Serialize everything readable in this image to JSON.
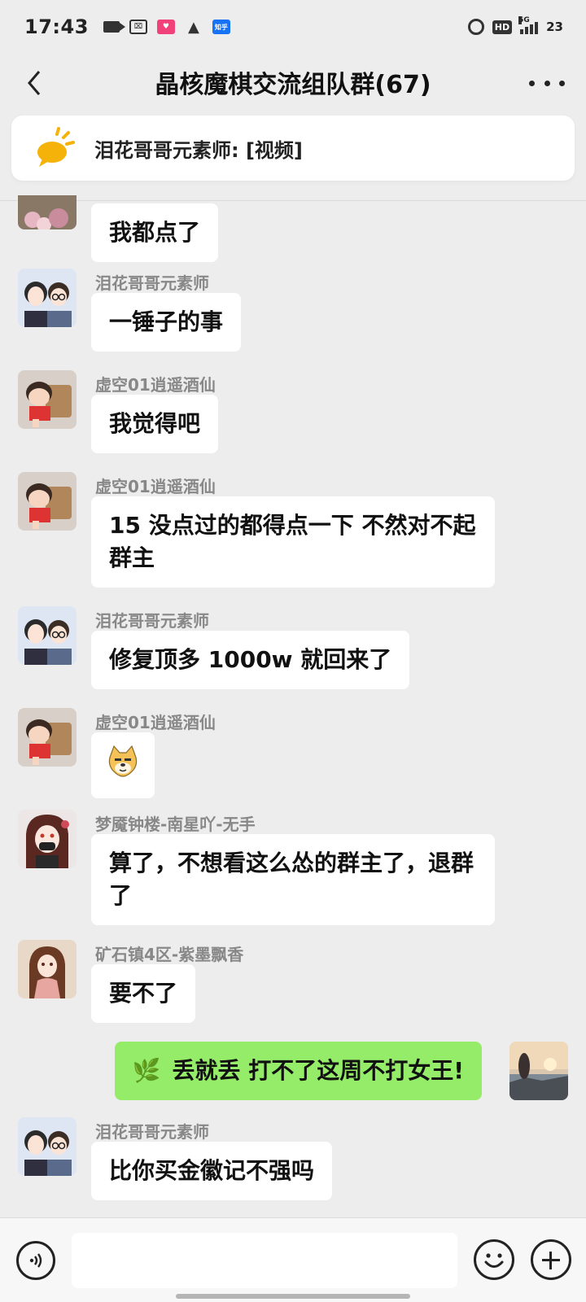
{
  "status_bar": {
    "time": "17:43",
    "app_icons": [
      "video-icon",
      "scan-icon",
      "pink-app-icon",
      "bird-icon",
      "zhihu-icon"
    ],
    "zhihu_label": "知乎",
    "hd_label": "HD",
    "network": "5G",
    "battery": "23"
  },
  "header": {
    "title": "晶核魔棋交流组队群(67)"
  },
  "pinned": {
    "text": "泪花哥哥元素师: [视频]"
  },
  "messages": [
    {
      "sender": "",
      "text": "我都点了",
      "self": false,
      "avatar": "flowers-avatar"
    },
    {
      "sender": "泪花哥哥元素师",
      "text": "一锤子的事",
      "self": false,
      "avatar": "couple-avatar"
    },
    {
      "sender": "虚空01逍遥酒仙",
      "text": "我觉得吧",
      "self": false,
      "avatar": "shinchan-avatar"
    },
    {
      "sender": "虚空01逍遥酒仙",
      "text": "15 没点过的都得点一下 不然对不起群主",
      "self": false,
      "avatar": "shinchan-avatar"
    },
    {
      "sender": "泪花哥哥元素师",
      "text": "修复顶多 1000w 就回来了",
      "self": false,
      "avatar": "couple-avatar"
    },
    {
      "sender": "虚空01逍遥酒仙",
      "text": "",
      "self": false,
      "avatar": "shinchan-avatar",
      "emoji": "doge-emoji"
    },
    {
      "sender": "梦魇钟楼-南星吖-无手",
      "text": "算了，不想看这么怂的群主了，退群了",
      "self": false,
      "avatar": "anime-girl-avatar"
    },
    {
      "sender": "矿石镇4区-紫墨飘香",
      "text": "要不了",
      "self": false,
      "avatar": "anime-girl2-avatar"
    },
    {
      "sender": "",
      "text": "丢就丢 打不了这周不打女王!",
      "self": true,
      "avatar": "sunset-avatar"
    },
    {
      "sender": "泪花哥哥元素师",
      "text": "比你买金徽记不强吗",
      "self": false,
      "avatar": "couple-avatar"
    }
  ],
  "colors": {
    "background": "#ededed",
    "self_bubble": "#95ec69",
    "other_bubble": "#ffffff"
  }
}
